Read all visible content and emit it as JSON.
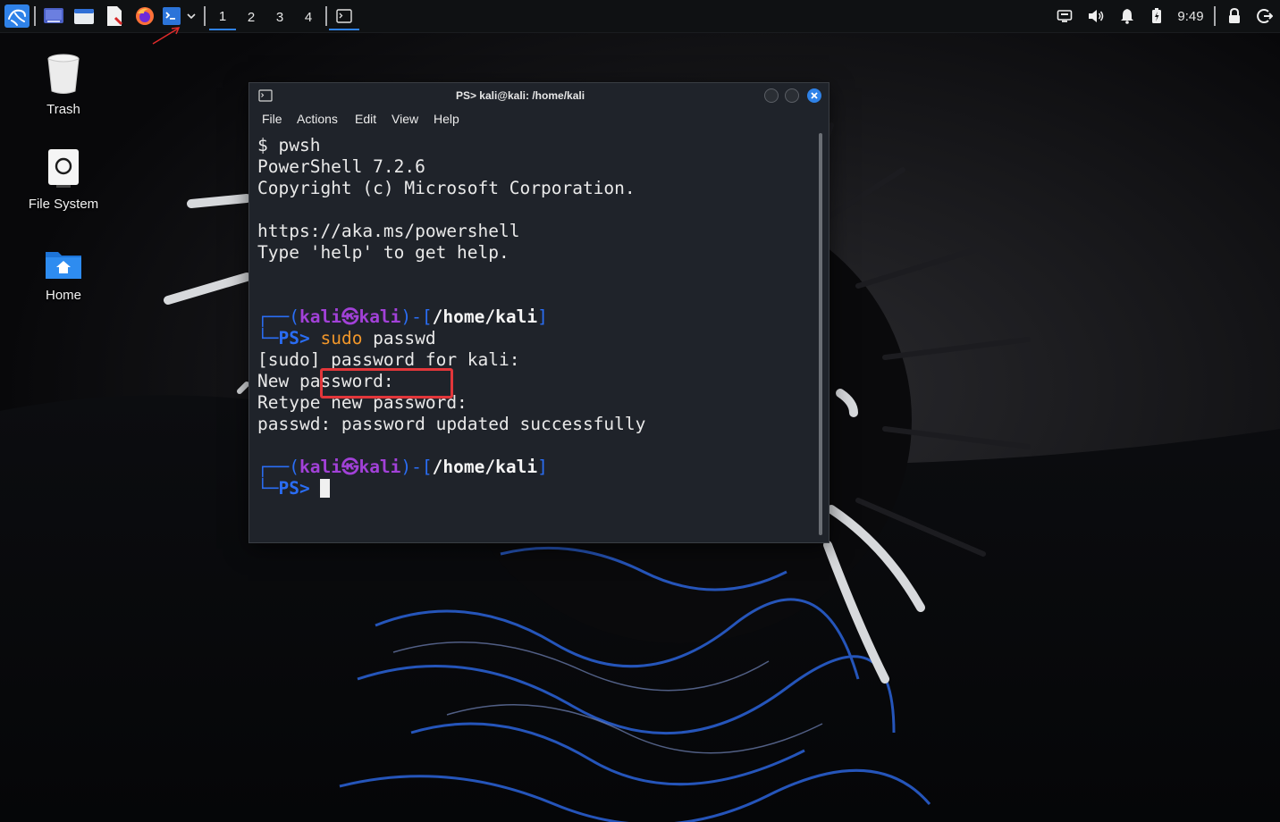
{
  "panel": {
    "launchers": [
      "kali-menu-icon",
      "show-desktop-icon",
      "file-manager-icon",
      "text-editor-icon",
      "firefox-icon",
      "terminal-icon"
    ],
    "workspaces": [
      "1",
      "2",
      "3",
      "4"
    ],
    "active_workspace": "1",
    "clock": "9:49",
    "tray_icons": [
      "display-icon",
      "volume-icon",
      "notification-bell-icon",
      "battery-icon",
      "lock-icon",
      "logout-icon"
    ]
  },
  "desktop": {
    "icons": [
      {
        "label": "Trash",
        "icon": "trash-icon"
      },
      {
        "label": "File System",
        "icon": "drive-icon"
      },
      {
        "label": "Home",
        "icon": "home-folder-icon"
      }
    ]
  },
  "terminal": {
    "title": "PS> kali@kali: /home/kali",
    "menu": [
      "File",
      "Actions",
      "Edit",
      "View",
      "Help"
    ],
    "lines": {
      "l1": "$ pwsh",
      "l2": "PowerShell 7.2.6",
      "l3": "Copyright (c) Microsoft Corporation.",
      "l4": "https://aka.ms/powershell",
      "l5": "Type 'help' to get help.",
      "l7": "[sudo] password for kali:",
      "l8": "New password:",
      "l9": "Retype new password:",
      "l10": "passwd: password updated successfully"
    },
    "prompt": {
      "frame_top": "┌──(",
      "user": "kali",
      "at": "㉿",
      "host": "kali",
      "frame_mid": ")-[",
      "cwd": "/home/kali",
      "frame_end": "]",
      "frame_bottom": "└─",
      "ps": "PS>"
    },
    "command": {
      "sudo": "sudo",
      "rest": " passwd"
    },
    "colors": {
      "prompt_blue": "#2a6df4",
      "prompt_purple": "#a241d8",
      "sudo_orange": "#f0962a",
      "highlight_red": "#e2363a"
    }
  }
}
